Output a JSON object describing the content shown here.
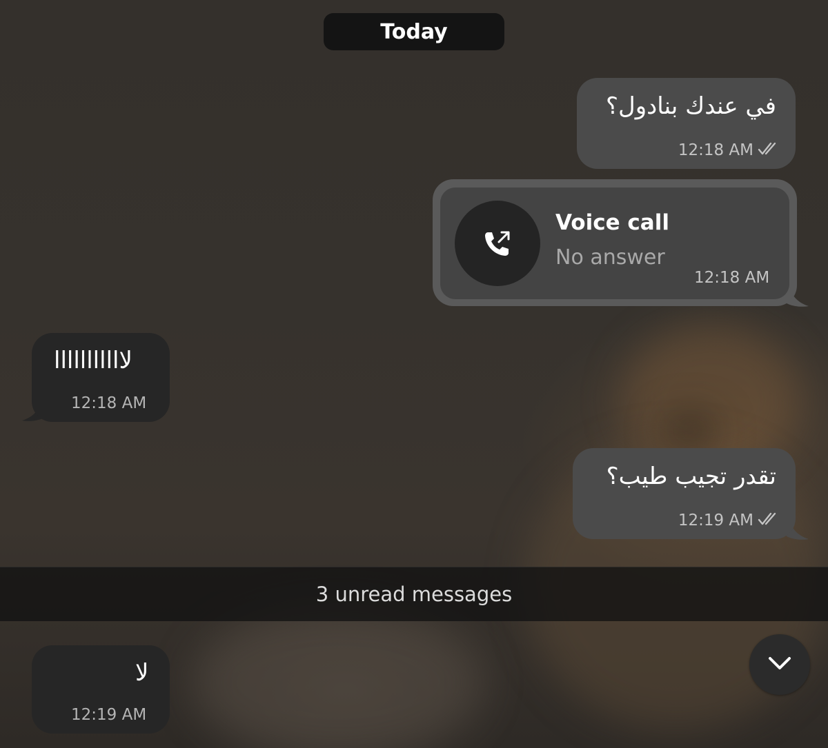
{
  "date_divider": "Today",
  "messages": [
    {
      "direction": "out",
      "text": "في عندك بنادول؟",
      "time": "12:18 AM",
      "status_icon": "double-check-icon"
    },
    {
      "direction": "out",
      "type": "call",
      "title": "Voice call",
      "subtitle": "No answer",
      "time": "12:18 AM",
      "icon": "outgoing-call-icon"
    },
    {
      "direction": "in",
      "text": "لااااااااااا",
      "time": "12:18 AM"
    },
    {
      "direction": "out",
      "text": "تقدر تجيب طيب؟",
      "time": "12:19 AM",
      "status_icon": "double-check-icon"
    },
    {
      "direction": "in",
      "text": "لا",
      "time": "12:19 AM"
    }
  ],
  "unread_banner": "3 unread messages",
  "scroll_button_icon": "chevron-down-icon",
  "colors": {
    "outgoing_bubble": "#4b4b4b",
    "incoming_bubble": "#262626",
    "date_pill": "#141414",
    "meta_text": "#b5b5b5"
  }
}
